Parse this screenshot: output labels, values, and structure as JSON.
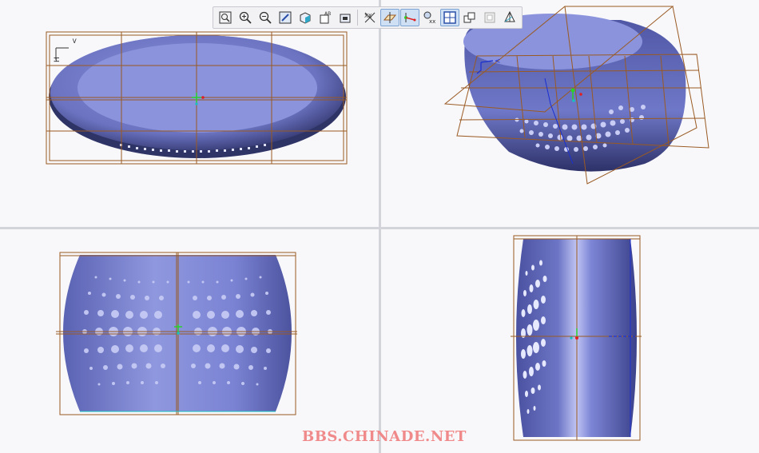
{
  "watermark": {
    "text": "BBS.CHINADE.NET"
  },
  "colors": {
    "body": "#7d86d6",
    "body_dark": "#3d4380",
    "datum_plane": "#9a5a22",
    "csys_blue": "#1a2fd1",
    "hole": "#c9cdf6",
    "background": "#f8f8fb"
  },
  "toolbar": {
    "buttons": [
      {
        "name": "refit-button",
        "icon": "refit-icon"
      },
      {
        "name": "zoom-in-button",
        "icon": "zoom-in-icon"
      },
      {
        "name": "zoom-out-button",
        "icon": "zoom-out-icon"
      },
      {
        "name": "repaint-button",
        "icon": "repaint-icon"
      },
      {
        "name": "display-style-button",
        "icon": "display-style-icon"
      },
      {
        "name": "saved-views-button",
        "icon": "saved-views-icon"
      },
      {
        "name": "view-manager-button",
        "icon": "view-manager-icon"
      },
      {
        "name": "annotation-display-button",
        "icon": "annotation-icon"
      },
      {
        "name": "datum-plane-display-button",
        "icon": "datum-plane-icon",
        "active": true
      },
      {
        "name": "datum-axis-display-button",
        "icon": "datum-axis-icon",
        "active": true
      },
      {
        "name": "point-display-button",
        "icon": "point-display-icon"
      },
      {
        "name": "csys-display-button",
        "icon": "csys-display-icon",
        "active": true
      },
      {
        "name": "spin-center-button",
        "icon": "spin-center-icon"
      },
      {
        "name": "perspective-button",
        "icon": "perspective-icon"
      },
      {
        "name": "named-view-button",
        "icon": "named-view-icon"
      }
    ]
  },
  "csys_labels": {
    "top_left": {
      "x_axis": "H",
      "y_axis": "<"
    },
    "top_right": {
      "y_axis": "<"
    }
  }
}
